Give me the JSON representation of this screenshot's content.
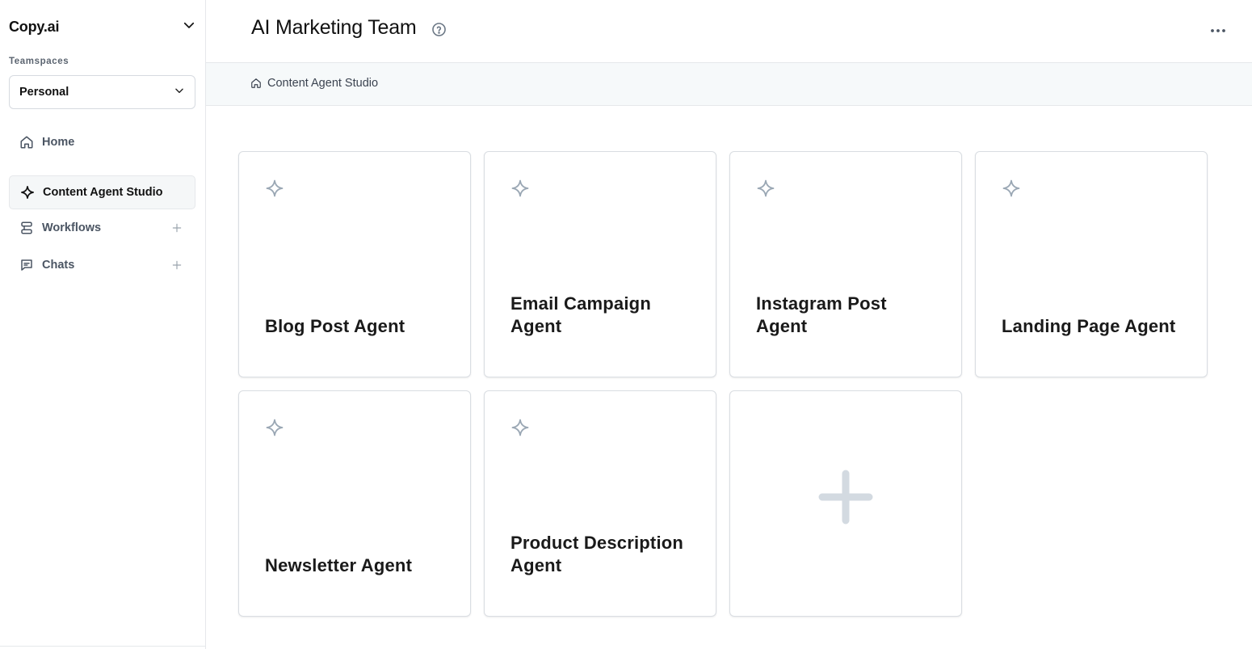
{
  "sidebar": {
    "brand": "Copy.ai",
    "teamspaces_label": "Teamspaces",
    "teamspace_value": "Personal",
    "items": [
      {
        "label": "Home"
      },
      {
        "label": "Content Agent Studio"
      },
      {
        "label": "Workflows"
      },
      {
        "label": "Chats"
      }
    ]
  },
  "header": {
    "title": "AI Marketing Team"
  },
  "breadcrumb": {
    "label": "Content Agent Studio"
  },
  "cards": [
    {
      "title": "Blog Post Agent"
    },
    {
      "title": "Email Campaign Agent"
    },
    {
      "title": "Instagram Post Agent"
    },
    {
      "title": "Landing Page Agent"
    },
    {
      "title": "Newsletter Agent"
    },
    {
      "title": "Product Description Agent"
    }
  ],
  "colors": {
    "accent_icon": "#9aa7b4",
    "text_primary": "#1a1a1a",
    "border": "#d9dde2",
    "breadcrumb_bg": "#f6f9fa"
  }
}
